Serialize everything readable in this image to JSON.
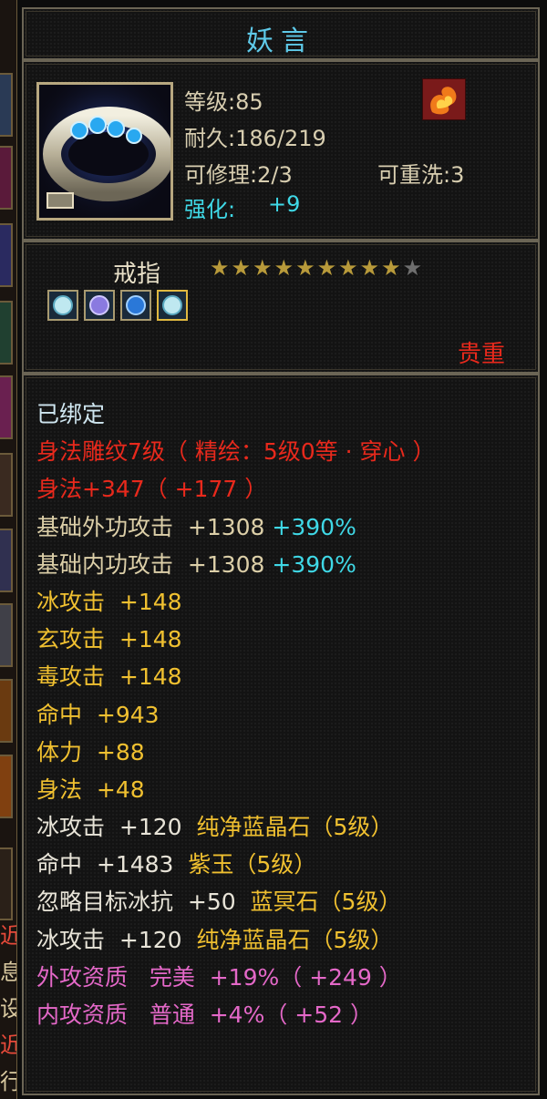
{
  "item": {
    "name": "妖言",
    "level": "等级:85",
    "durability": "耐久:186/219",
    "repairable": "可修理:2/3",
    "rewash": "可重洗:3",
    "enhance_label": "强化:",
    "enhance_value": "+9",
    "type": "戒指",
    "stars_total": 10,
    "stars_filled": 9,
    "rarity": "贵重",
    "icon": "silver-ring-with-blue-gems",
    "badge_icon": "fire-swirl-icon",
    "gem_icons": [
      "white-crystal-gem",
      "purple-crystal-gem",
      "blue-crystal-gem",
      "white-crystal-gem"
    ]
  },
  "attributes": [
    {
      "segments": [
        {
          "text": "已绑定",
          "color": "#cfe6f0"
        }
      ]
    },
    {
      "segments": [
        {
          "text": "身法雕纹7级（ 精绘：5级0等 · 穿心 ）",
          "color": "#e8291c"
        }
      ]
    },
    {
      "segments": [
        {
          "text": "身法+347（ +177 ）",
          "color": "#e8291c"
        }
      ]
    },
    {
      "segments": [
        {
          "text": "基础外功攻击  +1308 ",
          "color": "#dccfa8"
        },
        {
          "text": "+390%",
          "color": "#3fd8e6"
        }
      ]
    },
    {
      "segments": [
        {
          "text": "基础内功攻击  +1308 ",
          "color": "#dccfa8"
        },
        {
          "text": "+390%",
          "color": "#3fd8e6"
        }
      ]
    },
    {
      "segments": [
        {
          "text": "冰攻击  +148",
          "color": "#f0c030"
        }
      ]
    },
    {
      "segments": [
        {
          "text": "玄攻击  +148",
          "color": "#f0c030"
        }
      ]
    },
    {
      "segments": [
        {
          "text": "毒攻击  +148",
          "color": "#f0c030"
        }
      ]
    },
    {
      "segments": [
        {
          "text": "命中  +943",
          "color": "#f0c030"
        }
      ]
    },
    {
      "segments": [
        {
          "text": "体力  +88",
          "color": "#f0c030"
        }
      ]
    },
    {
      "segments": [
        {
          "text": "身法  +48",
          "color": "#f0c030"
        }
      ]
    },
    {
      "segments": [
        {
          "text": "冰攻击  +120  ",
          "color": "#e8e4d8"
        },
        {
          "text": "纯净蓝晶石（5级）",
          "color": "#f0c030"
        }
      ]
    },
    {
      "segments": [
        {
          "text": "命中  +1483  ",
          "color": "#e8e4d8"
        },
        {
          "text": "紫玉（5级）",
          "color": "#f0c030"
        }
      ]
    },
    {
      "segments": [
        {
          "text": "忽略目标冰抗  +50  ",
          "color": "#e8e4d8"
        },
        {
          "text": "蓝冥石（5级）",
          "color": "#f0c030"
        }
      ]
    },
    {
      "segments": [
        {
          "text": "冰攻击  +120  ",
          "color": "#e8e4d8"
        },
        {
          "text": "纯净蓝晶石（5级）",
          "color": "#f0c030"
        }
      ]
    },
    {
      "segments": [
        {
          "text": "外攻资质   完美  +19%（ +249 ）",
          "color": "#e468c8"
        }
      ]
    },
    {
      "segments": [
        {
          "text": "内攻资质   普通  +4%（ +52 ）",
          "color": "#e468c8"
        }
      ]
    }
  ],
  "left_edge_chars": [
    "近",
    "息",
    "设",
    "近",
    "行"
  ]
}
